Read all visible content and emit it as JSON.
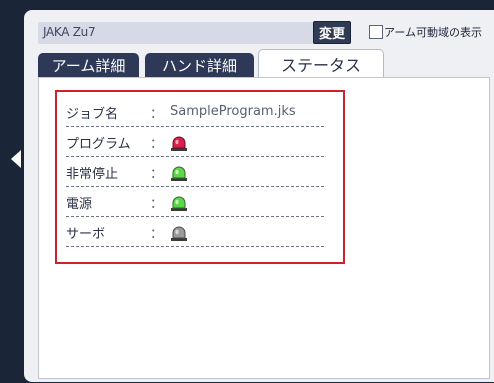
{
  "header": {
    "robot_name": "JAKA Zu7",
    "change_label": "変更",
    "range_display_label": "アーム可動域の表示"
  },
  "tabs": [
    {
      "label": "アーム詳細"
    },
    {
      "label": "ハンド詳細"
    },
    {
      "label": "ステータス"
    }
  ],
  "status": {
    "rows": [
      {
        "label": "ジョブ名",
        "colon": "：",
        "value": "SampleProgram.jks"
      },
      {
        "label": "プログラム",
        "colon": "：",
        "lamp": "red-lamp-icon",
        "lamp_color": "#d8204a"
      },
      {
        "label": "非常停止",
        "colon": "：",
        "lamp": "green-lamp-icon",
        "lamp_color": "#5cd64a"
      },
      {
        "label": "電源",
        "colon": "：",
        "lamp": "green-lamp-icon",
        "lamp_color": "#5cd64a"
      },
      {
        "label": "サーボ",
        "colon": "：",
        "lamp": "gray-lamp-icon",
        "lamp_color": "#9a9a9a"
      }
    ]
  },
  "colors": {
    "tab_active_bg": "#ffffff",
    "tab_inactive_bg": "#2e3957",
    "highlight_frame": "#d21f2c",
    "button_bg": "#2f3a55"
  }
}
